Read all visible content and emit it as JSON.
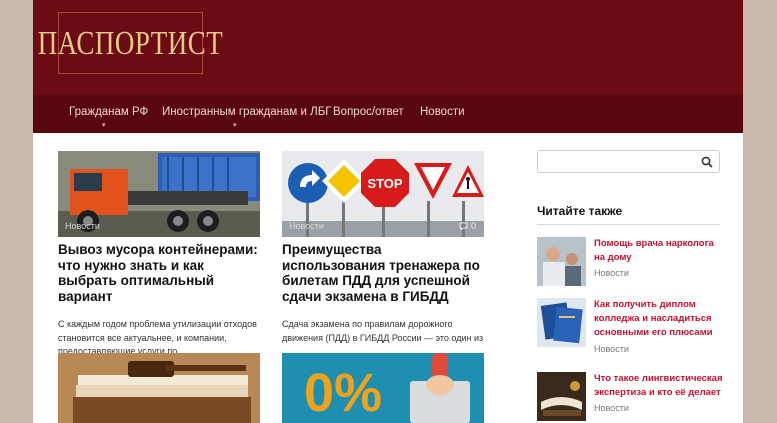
{
  "header": {
    "logo_text": "ПАСПОРТИСТ"
  },
  "nav": {
    "items": [
      {
        "label": "Гражданам РФ",
        "has_submenu": true
      },
      {
        "label": "Иностранным гражданам и ЛБГ",
        "has_submenu": true
      },
      {
        "label": "Вопрос/ответ",
        "has_submenu": false
      },
      {
        "label": "Новости",
        "has_submenu": false
      }
    ],
    "submenu_arrow": "▾"
  },
  "posts": [
    {
      "category": "Новости",
      "comments": "",
      "title": "Вывоз мусора контейнерами: что нужно знать и как выбрать оптимальный вариант",
      "excerpt": "С каждым годом проблема утилизации отходов становится все актуальнее, и компании, предоставляющие услуги по"
    },
    {
      "category": "Новости",
      "comments": "0",
      "title": "Преимущества использования тренажера по билетам ПДД для успешной сдачи экзамена в ГИБДД",
      "excerpt": "Сдача экзамена по правилам дорожного движения (ПДД) в ГИБДД России — это один из"
    }
  ],
  "sign_text": "STOP",
  "percent_text": "0%",
  "search": {
    "placeholder": ""
  },
  "sidebar": {
    "widget_title": "Читайте также",
    "items": [
      {
        "title": "Помощь врача нарколога на дому",
        "category": "Новости"
      },
      {
        "title": "Как получить диплом колледжа и насладиться основными его плюсами",
        "category": "Новости"
      },
      {
        "title": "Что такое лингвистическая экспертиза и кто её делает",
        "category": "Новости"
      }
    ]
  },
  "colors": {
    "header_bg": "#6b0c14",
    "nav_bg": "#58070e",
    "logo_text": "#e8c98a",
    "accent_red": "#c8102e"
  },
  "icons": [
    "search-icon",
    "comment-icon",
    "chevron-down-icon"
  ]
}
